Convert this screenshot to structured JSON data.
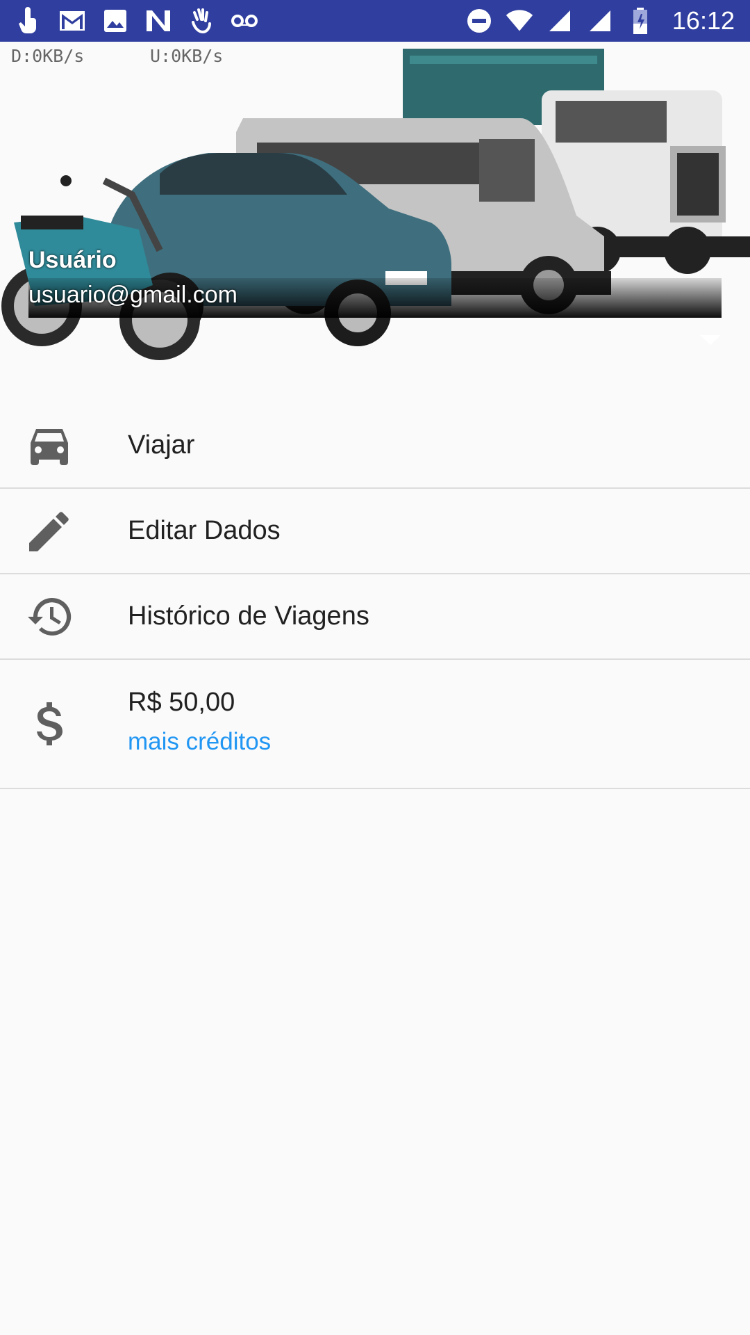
{
  "status_bar": {
    "time": "16:12",
    "left_icons": [
      "touch-icon",
      "gmail-icon",
      "image-icon",
      "n-app-icon",
      "hand-app-icon",
      "voicemail-icon"
    ],
    "right_icons": [
      "do-not-disturb-icon",
      "wifi-icon",
      "signal-icon",
      "signal-icon-2",
      "battery-icon"
    ],
    "color": "#303f9f"
  },
  "header": {
    "download_speed": "D:0KB/s",
    "upload_speed": "U:0KB/s",
    "user_name": "Usuário",
    "user_email": "usuario@gmail.com"
  },
  "menu": {
    "items": [
      {
        "label": "Viajar",
        "icon": "car-icon"
      },
      {
        "label": "Editar Dados",
        "icon": "pencil-icon"
      },
      {
        "label": "Histórico de Viagens",
        "icon": "history-icon"
      }
    ],
    "credits": {
      "balance": "R$ 50,00",
      "link": "mais créditos",
      "icon": "dollar-icon",
      "link_color": "#2196f3"
    }
  }
}
